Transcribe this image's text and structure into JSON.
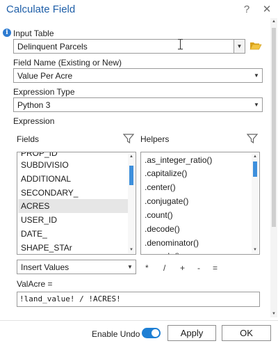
{
  "dialog": {
    "title": "Calculate Field"
  },
  "titlebar": {
    "help_label": "?",
    "close_label": "✕"
  },
  "input_table": {
    "label": "Input Table",
    "value": "Delinquent Parcels"
  },
  "field_name": {
    "label": "Field Name (Existing or New)",
    "value": "Value Per Acre"
  },
  "expression_type": {
    "label": "Expression Type",
    "value": "Python 3"
  },
  "expression": {
    "label": "Expression"
  },
  "fields_panel": {
    "label": "Fields",
    "items": [
      "PROP_ID",
      "SUBDIVISIO",
      "ADDITIONAL",
      "SECONDARY_",
      "ACRES",
      "USER_ID",
      "DATE_",
      "SHAPE_STAr"
    ],
    "selected_index": 4
  },
  "helpers_panel": {
    "label": "Helpers",
    "items": [
      ".as_integer_ratio()",
      ".capitalize()",
      ".center()",
      ".conjugate()",
      ".count()",
      ".decode()",
      ".denominator()",
      ".encode()"
    ]
  },
  "insert_values": {
    "value": "Insert Values"
  },
  "operators": [
    "*",
    "/",
    "+",
    "-",
    "="
  ],
  "code": {
    "label": "ValAcre =",
    "value": "!land_value! / !ACRES!"
  },
  "footer": {
    "enable_undo_label": "Enable Undo",
    "enable_undo_on": true,
    "apply_label": "Apply",
    "ok_label": "OK"
  },
  "colors": {
    "title": "#1f5fa8",
    "accent": "#1e7fd4"
  }
}
